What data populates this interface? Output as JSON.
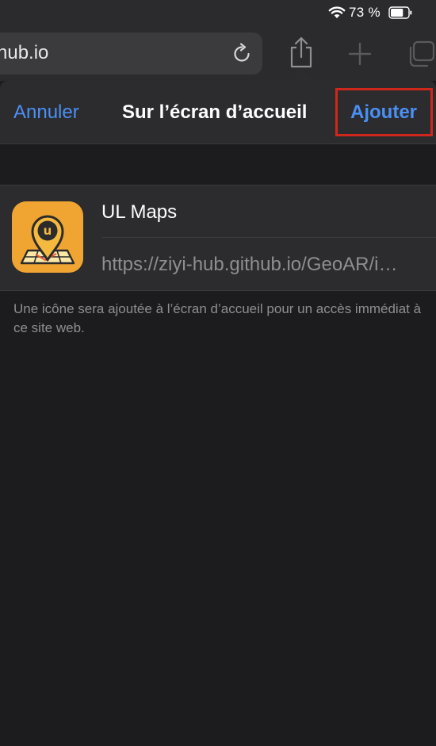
{
  "status_bar": {
    "battery_percent": "73 %",
    "battery_level": 0.73
  },
  "browser": {
    "address_text": "hub.io"
  },
  "sheet": {
    "cancel_label": "Annuler",
    "title": "Sur l’écran d’accueil",
    "add_label": "Ajouter",
    "app": {
      "name": "UL Maps",
      "url": "https://ziyi-hub.github.io/GeoAR/i…",
      "icon": "ul-maps-logo",
      "icon_color": "#f0a533",
      "icon_text": "u"
    },
    "footer_note": "Une icône sera ajoutée à l’écran d’accueil pour un accès immédiat à ce site web."
  },
  "colors": {
    "accent": "#4a90f5",
    "highlight_frame": "#d0271d",
    "background": "#1c1c1e",
    "surface": "#2c2c2e"
  }
}
